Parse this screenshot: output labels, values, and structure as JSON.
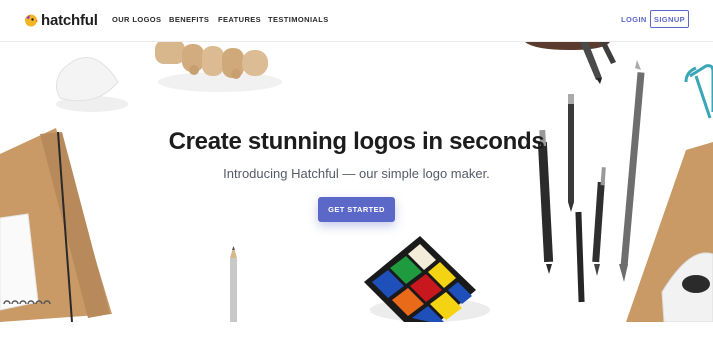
{
  "brand": {
    "name": "hatchful",
    "logo_icon": "hatchful-chick-icon",
    "accent": "#5c68c7",
    "logo_color": "#f2b526"
  },
  "nav": {
    "links": [
      "OUR LOGOS",
      "BENEFITS",
      "FEATURES",
      "TESTIMONIALS"
    ],
    "login": "LOGIN",
    "signup": "SIGNUP"
  },
  "hero": {
    "headline": "Create stunning logos in seconds",
    "subheadline": "Introducing Hatchful — our simple logo maker.",
    "cta": "GET STARTED",
    "decorations": [
      "wooden-hand-figure",
      "eraser",
      "notebook",
      "pens-and-pencils",
      "rubiks-cube",
      "paper-clip",
      "stapler",
      "pencil"
    ]
  }
}
